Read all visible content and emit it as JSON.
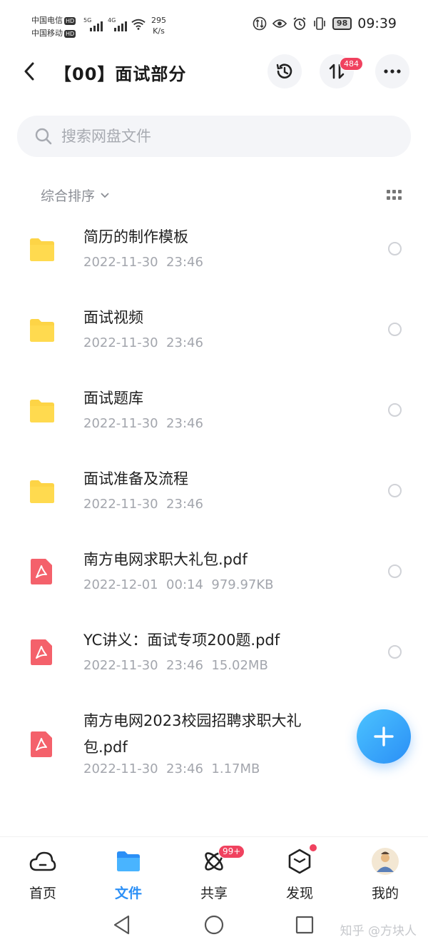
{
  "status_bar": {
    "carrier1": "中国电信",
    "carrier2": "中国移动",
    "hd": "HD",
    "net1": "5G",
    "net2": "4G",
    "speed_value": "295",
    "speed_unit": "K/s",
    "battery": "98",
    "time": "09:39"
  },
  "header": {
    "title": "【00】面试部分",
    "transfer_badge": "484"
  },
  "search": {
    "placeholder": "搜索网盘文件"
  },
  "sort": {
    "label": "综合排序"
  },
  "files": [
    {
      "name": "简历的制作模板",
      "date": "2022-11-30  23:46",
      "type": "folder"
    },
    {
      "name": "面试视频",
      "date": "2022-11-30  23:46",
      "type": "folder"
    },
    {
      "name": "面试题库",
      "date": "2022-11-30  23:46",
      "type": "folder"
    },
    {
      "name": "面试准备及流程",
      "date": "2022-11-30  23:46",
      "type": "folder"
    },
    {
      "name": "南方电网求职大礼包.pdf",
      "date": "2022-12-01  00:14",
      "size": "979.97KB",
      "type": "pdf"
    },
    {
      "name": "YC讲义：面试专项200题.pdf",
      "date": "2022-11-30  23:46",
      "size": "15.02MB",
      "type": "pdf"
    },
    {
      "name": "南方电网2023校园招聘求职大礼包.pdf",
      "date": "2022-11-30  23:46",
      "size": "1.17MB",
      "type": "pdf"
    }
  ],
  "tabs": [
    {
      "label": "首页"
    },
    {
      "label": "文件"
    },
    {
      "label": "共享",
      "badge": "99+"
    },
    {
      "label": "发现"
    },
    {
      "label": "我的"
    }
  ],
  "watermark": "知乎 @方块人",
  "colors": {
    "accent": "#2b8ff6",
    "badge": "#f0425f",
    "folder": "#fdd446",
    "pdf": "#f4616b"
  }
}
